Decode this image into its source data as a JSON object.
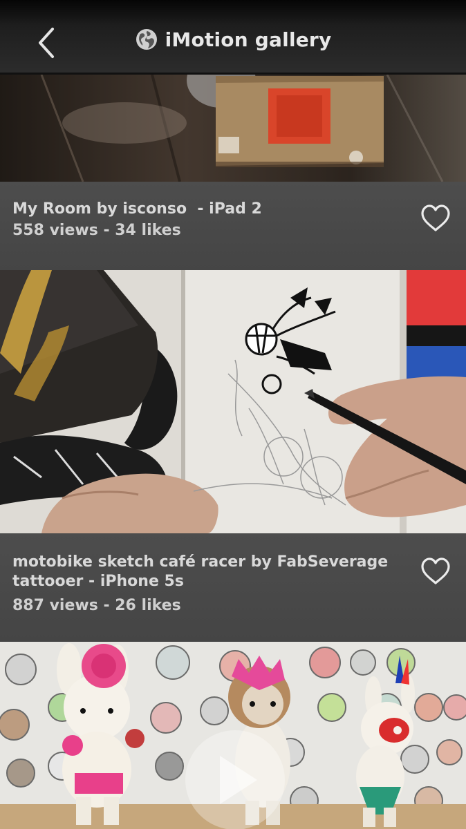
{
  "header": {
    "title": "iMotion gallery",
    "back_icon": "chevron-left-icon",
    "logo_icon": "globe-icon"
  },
  "gallery": {
    "items": [
      {
        "title_lines": [
          "My Room by isconso  - iPad 2"
        ],
        "stats": "558 views - 34 likes",
        "like_icon": "heart-outline-icon"
      },
      {
        "title_lines": [
          "motobike sketch café racer by FabSeverage",
          "tattooer - iPhone 5s"
        ],
        "stats": "887 views - 26 likes",
        "like_icon": "heart-outline-icon"
      },
      {
        "play_icon": "play-icon"
      }
    ]
  },
  "colors": {
    "header_bg": "#1e1e1e",
    "panel_bg": "#4a4a4a",
    "text": "#d9d9d9"
  }
}
